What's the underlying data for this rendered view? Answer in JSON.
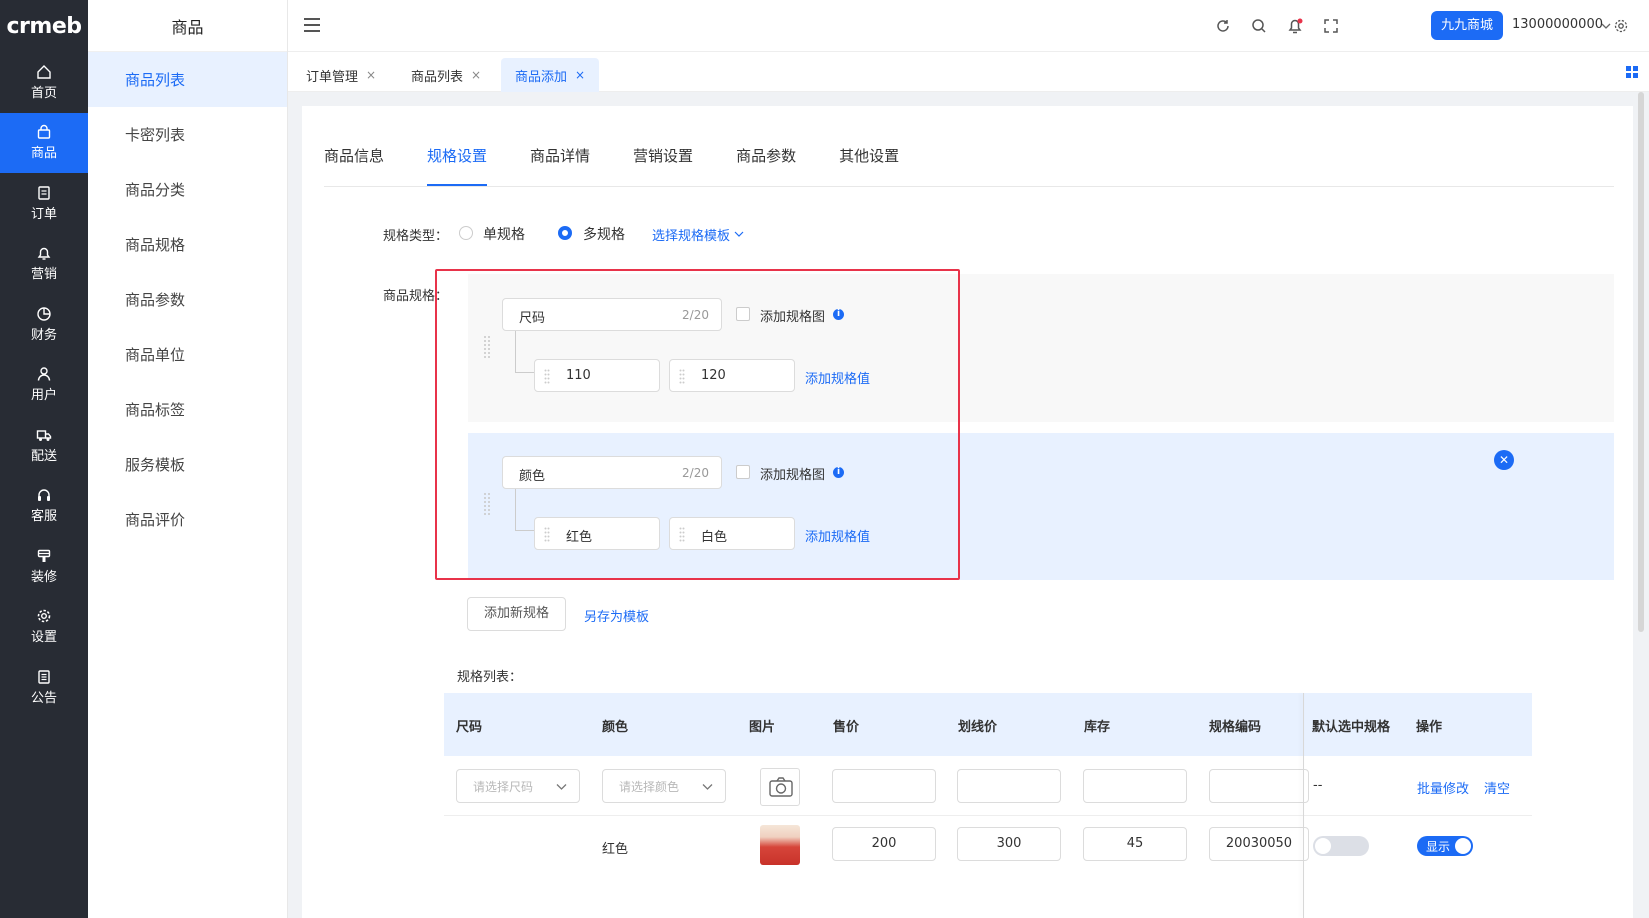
{
  "brand": {
    "logo_text": "crmeb",
    "accent": "#1c6bf5",
    "rail_bg": "#282c34",
    "highlight_red": "#e8334a"
  },
  "rail": [
    {
      "label": "首页",
      "icon": "home-icon",
      "active": false
    },
    {
      "label": "商品",
      "icon": "bag-icon",
      "active": true
    },
    {
      "label": "订单",
      "icon": "document-icon",
      "active": false
    },
    {
      "label": "营销",
      "icon": "bell-icon",
      "active": false
    },
    {
      "label": "财务",
      "icon": "pie-chart-icon",
      "active": false
    },
    {
      "label": "用户",
      "icon": "user-icon",
      "active": false
    },
    {
      "label": "配送",
      "icon": "truck-icon",
      "active": false
    },
    {
      "label": "客服",
      "icon": "headset-icon",
      "active": false
    },
    {
      "label": "装修",
      "icon": "paint-icon",
      "active": false
    },
    {
      "label": "设置",
      "icon": "gear-icon",
      "active": false
    },
    {
      "label": "公告",
      "icon": "notice-icon",
      "active": false
    }
  ],
  "subside": {
    "title": "商品",
    "items": [
      "商品列表",
      "卡密列表",
      "商品分类",
      "商品规格",
      "商品参数",
      "商品单位",
      "商品标签",
      "服务模板",
      "商品评价"
    ]
  },
  "header": {
    "store_label": "九九商城",
    "phone": "13000000000"
  },
  "tabs": [
    {
      "label": "订单管理",
      "close": "×"
    },
    {
      "label": "商品列表",
      "close": "×"
    },
    {
      "label": "商品添加",
      "close": "×"
    }
  ],
  "page_tabs": [
    "商品信息",
    "规格设置",
    "商品详情",
    "营销设置",
    "商品参数",
    "其他设置"
  ],
  "spec_type": {
    "label": "规格类型：",
    "single": "单规格",
    "multi": "多规格",
    "template_link": "选择规格模板",
    "selected": "多规格"
  },
  "spec": {
    "label": "商品规格：",
    "groups": [
      {
        "name": "尺码",
        "count": "2/20",
        "image_label": "添加规格图",
        "values": [
          "110",
          "120"
        ],
        "add_value": "添加规格值"
      },
      {
        "name": "颜色",
        "count": "2/20",
        "image_label": "添加规格图",
        "values": [
          "红色",
          "白色"
        ],
        "add_value": "添加规格值"
      }
    ],
    "add_spec": "添加新规格",
    "save_template": "另存为模板"
  },
  "spec_list": {
    "label": "规格列表：",
    "headers": [
      "尺码",
      "颜色",
      "图片",
      "售价",
      "划线价",
      "库存",
      "规格编码",
      "默认选中规格",
      "操作"
    ],
    "batch_row": {
      "size_placeholder": "请选择尺码",
      "color_placeholder": "请选择颜色",
      "default": "--",
      "batch_edit": "批量修改",
      "clear": "清空"
    },
    "rows": [
      {
        "color": "红色",
        "price": "200",
        "list_price": "300",
        "stock": "45",
        "code": "20030050",
        "default_selected": false,
        "status_label": "显示",
        "status_on": true
      }
    ]
  }
}
